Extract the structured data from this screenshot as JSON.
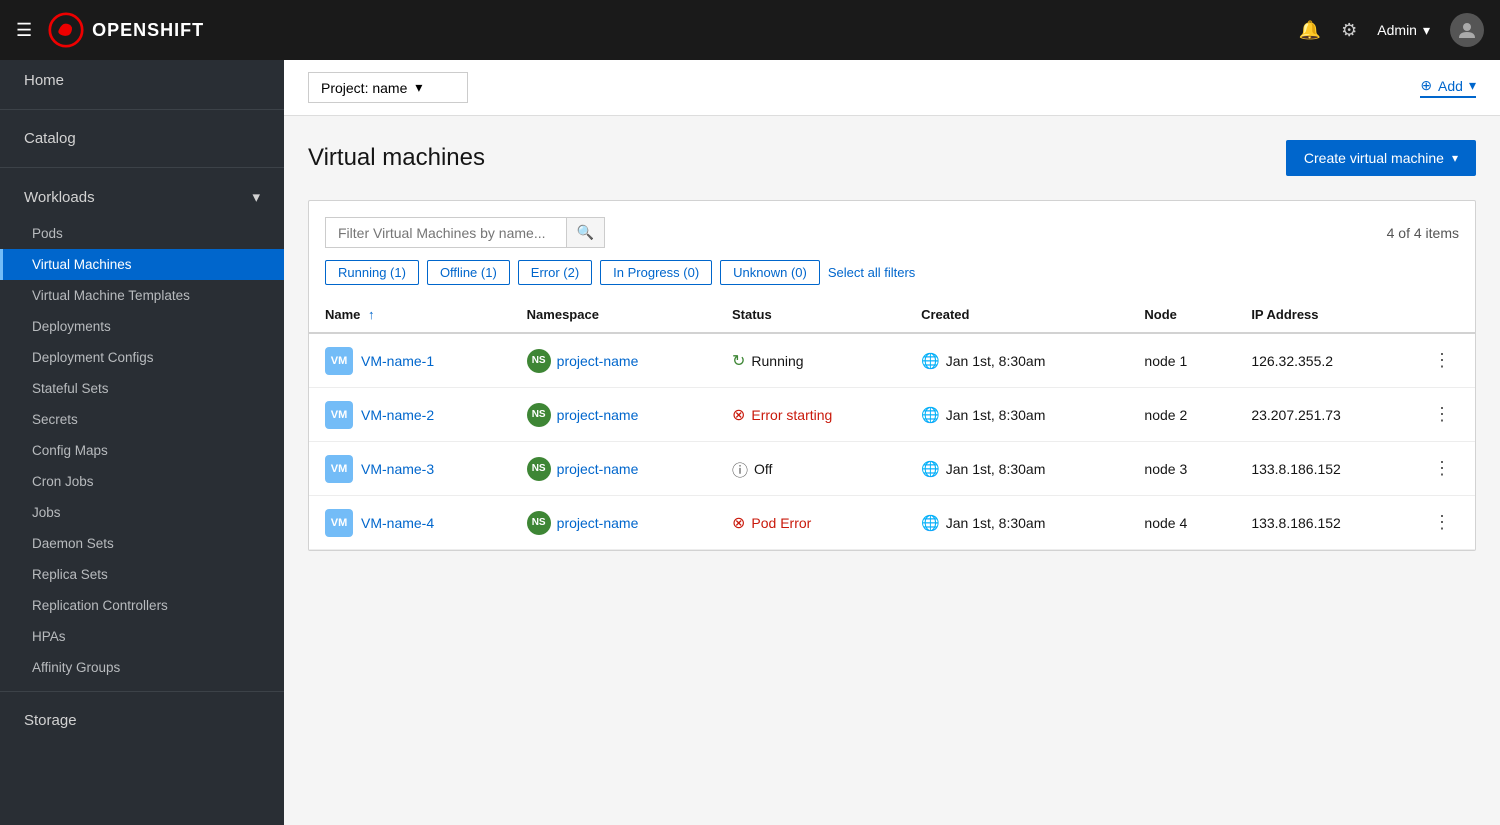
{
  "topnav": {
    "logo_text": "OPENSHIFT",
    "admin_label": "Admin",
    "chevron": "▾"
  },
  "project_bar": {
    "project_selector": "Project: name",
    "add_label": "+ Add",
    "chevron": "▾"
  },
  "page": {
    "title": "Virtual machines",
    "create_btn_label": "Create virtual machine",
    "items_count": "4 of 4 items"
  },
  "sidebar": {
    "home": "Home",
    "catalog": "Catalog",
    "workloads": "Workloads",
    "workloads_chevron": "▾",
    "items": [
      {
        "id": "pods",
        "label": "Pods",
        "active": false
      },
      {
        "id": "virtual-machines",
        "label": "Virtual Machines",
        "active": true
      },
      {
        "id": "virtual-machine-templates",
        "label": "Virtual Machine Templates",
        "active": false
      },
      {
        "id": "deployments",
        "label": "Deployments",
        "active": false
      },
      {
        "id": "deployment-configs",
        "label": "Deployment Configs",
        "active": false
      },
      {
        "id": "stateful-sets",
        "label": "Stateful Sets",
        "active": false
      },
      {
        "id": "secrets",
        "label": "Secrets",
        "active": false
      },
      {
        "id": "config-maps",
        "label": "Config Maps",
        "active": false
      },
      {
        "id": "cron-jobs",
        "label": "Cron Jobs",
        "active": false
      },
      {
        "id": "jobs",
        "label": "Jobs",
        "active": false
      },
      {
        "id": "daemon-sets",
        "label": "Daemon Sets",
        "active": false
      },
      {
        "id": "replica-sets",
        "label": "Replica Sets",
        "active": false
      },
      {
        "id": "replication-controllers",
        "label": "Replication Controllers",
        "active": false
      },
      {
        "id": "hpas",
        "label": "HPAs",
        "active": false
      },
      {
        "id": "affinity-groups",
        "label": "Affinity Groups",
        "active": false
      }
    ],
    "storage": "Storage"
  },
  "filters": {
    "search_placeholder": "Filter Virtual Machines by name...",
    "chips": [
      {
        "id": "running",
        "label": "Running (1)"
      },
      {
        "id": "offline",
        "label": "Offline (1)"
      },
      {
        "id": "error",
        "label": "Error (2)"
      },
      {
        "id": "in-progress",
        "label": "In Progress (0)"
      },
      {
        "id": "unknown",
        "label": "Unknown (0)"
      }
    ],
    "select_all": "Select all filters"
  },
  "table": {
    "columns": [
      {
        "id": "name",
        "label": "Name",
        "sortable": true,
        "sort_arrow": "↑"
      },
      {
        "id": "namespace",
        "label": "Namespace"
      },
      {
        "id": "status",
        "label": "Status"
      },
      {
        "id": "created",
        "label": "Created"
      },
      {
        "id": "node",
        "label": "Node"
      },
      {
        "id": "ip",
        "label": "IP Address"
      }
    ],
    "rows": [
      {
        "id": "vm1",
        "badge": "VM",
        "name": "VM-name-1",
        "ns_badge": "NS",
        "namespace": "project-name",
        "status_type": "running",
        "status_label": "Running",
        "created": "Jan 1st, 8:30am",
        "node": "node 1",
        "ip": "126.32.355.2"
      },
      {
        "id": "vm2",
        "badge": "VM",
        "name": "VM-name-2",
        "ns_badge": "NS",
        "namespace": "project-name",
        "status_type": "error",
        "status_label": "Error starting",
        "created": "Jan 1st, 8:30am",
        "node": "node 2",
        "ip": "23.207.251.73"
      },
      {
        "id": "vm3",
        "badge": "VM",
        "name": "VM-name-3",
        "ns_badge": "NS",
        "namespace": "project-name",
        "status_type": "off",
        "status_label": "Off",
        "created": "Jan 1st, 8:30am",
        "node": "node 3",
        "ip": "133.8.186.152"
      },
      {
        "id": "vm4",
        "badge": "VM",
        "name": "VM-name-4",
        "ns_badge": "NS",
        "namespace": "project-name",
        "status_type": "pod-error",
        "status_label": "Pod Error",
        "created": "Jan 1st, 8:30am",
        "node": "node 4",
        "ip": "133.8.186.152"
      }
    ]
  }
}
